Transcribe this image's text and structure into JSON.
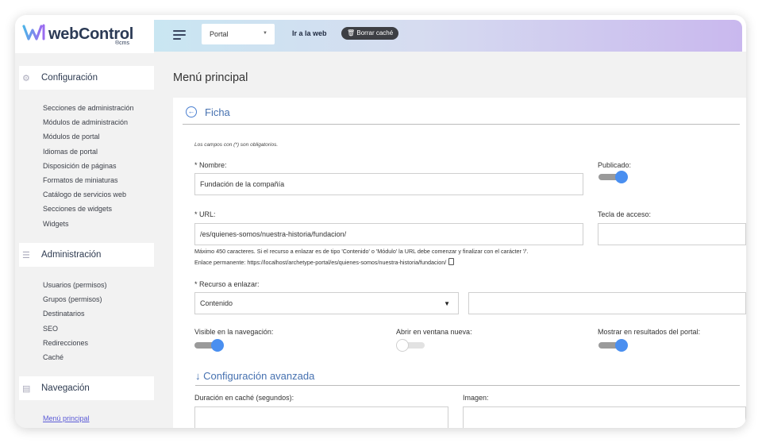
{
  "brand": {
    "name": "webControl",
    "sub": "®cms"
  },
  "sidebar": {
    "sections": [
      {
        "label": "Configuración",
        "icon": "gear-icon"
      },
      {
        "label": "Administración",
        "icon": "sliders-icon"
      },
      {
        "label": "Navegación",
        "icon": "menu-icon"
      }
    ],
    "config_items": [
      "Secciones de administración",
      "Módulos de administración",
      "Módulos de portal",
      "Idiomas de portal",
      "Disposición de páginas",
      "Formatos de miniaturas",
      "Catálogo de servicios web",
      "Secciones de widgets",
      "Widgets"
    ],
    "admin_items": [
      "Usuarios (permisos)",
      "Grupos (permisos)",
      "Destinatarios",
      "SEO",
      "Redirecciones",
      "Caché"
    ],
    "nav_items": [
      "Menú principal"
    ]
  },
  "topbar": {
    "portal_select": "Portal",
    "go_web": "Ir a la web",
    "cache_button": "Borrar caché"
  },
  "page": {
    "title": "Menú principal"
  },
  "form": {
    "section_title": "Ficha",
    "required_note": "Los campos con (*) son obligatorios.",
    "nombre_label": "* Nombre:",
    "nombre_value": "Fundación de la compañía",
    "publicado_label": "Publicado:",
    "publicado_on": true,
    "url_label": "* URL:",
    "url_value": "/es/quienes-somos/nuestra-historia/fundacion/",
    "tecla_label": "Tecla de acceso:",
    "tecla_value": "",
    "url_help": "Máximo 450 caracteres. Si el recurso a enlazar es de tipo 'Contenido' o 'Módulo' la URL debe comenzar y finalizar con el carácter '/'.",
    "permalink": "Enlace permanente: https://localhost/archetype-portal/es/quienes-somos/nuestra-historia/fundacion/",
    "recurso_label": "* Recurso a enlazar:",
    "recurso_value": "Contenido",
    "visible_label": "Visible en la navegación:",
    "visible_on": true,
    "ventana_label": "Abrir en ventana nueva:",
    "ventana_on": false,
    "mostrar_label": "Mostrar en resultados del portal:",
    "mostrar_on": true,
    "advanced_title": "↓ Configuración avanzada",
    "cache_label": "Duración en caché (segundos):",
    "imagen_label": "Imagen:"
  }
}
